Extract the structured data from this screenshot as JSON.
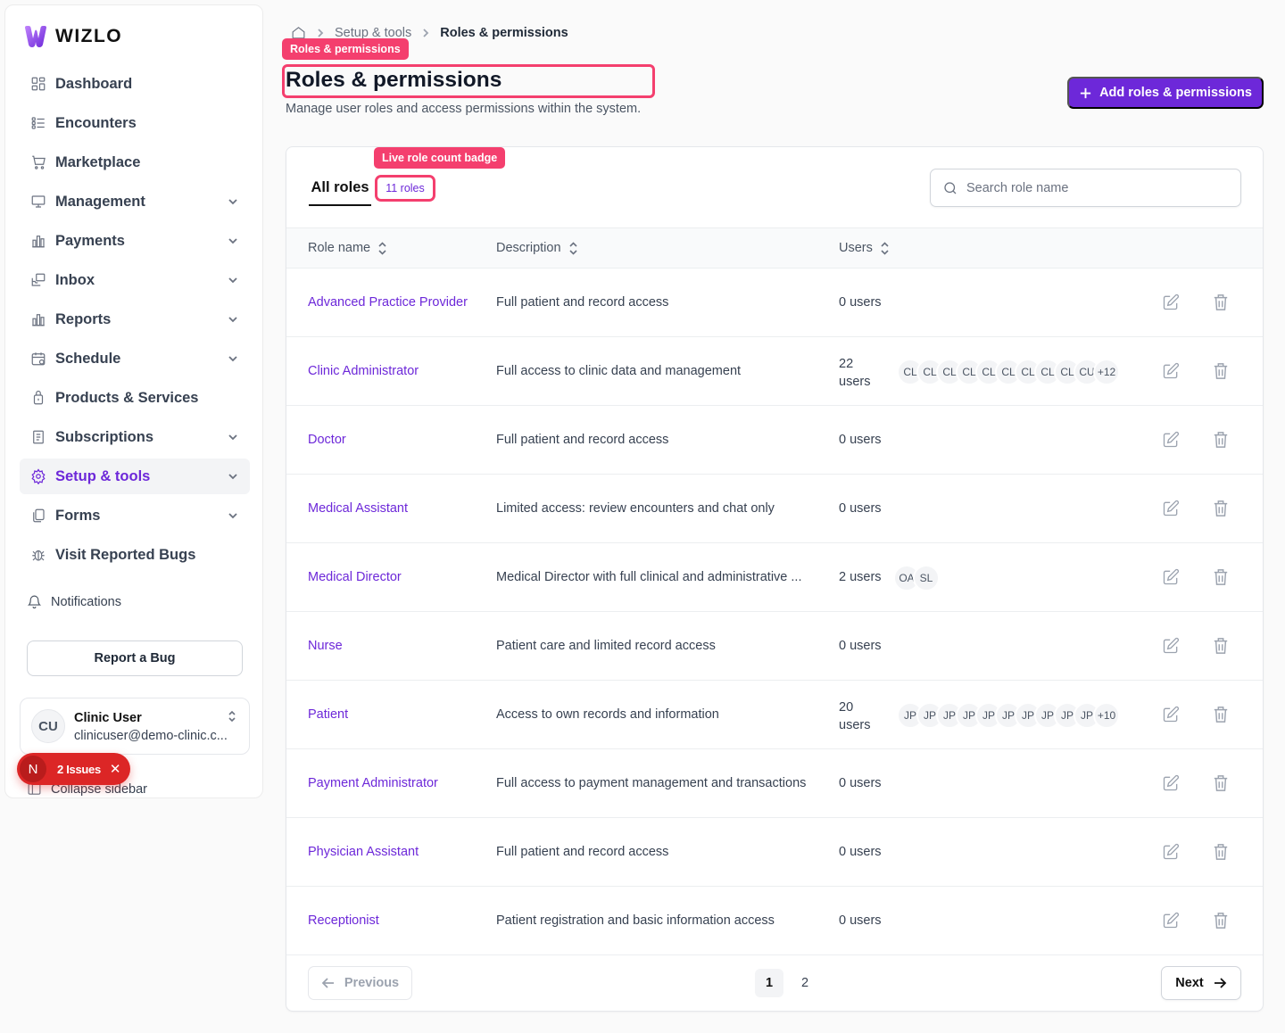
{
  "brand": {
    "name": "WIZLO"
  },
  "sidebar": {
    "items": [
      {
        "label": "Dashboard",
        "icon": "dashboard-icon",
        "chevron": false,
        "active": false
      },
      {
        "label": "Encounters",
        "icon": "list-icon",
        "chevron": false,
        "active": false
      },
      {
        "label": "Marketplace",
        "icon": "cart-icon",
        "chevron": false,
        "active": false
      },
      {
        "label": "Management",
        "icon": "monitor-icon",
        "chevron": true,
        "active": false
      },
      {
        "label": "Payments",
        "icon": "bar-chart-icon",
        "chevron": true,
        "active": false
      },
      {
        "label": "Inbox",
        "icon": "inbox-icon",
        "chevron": true,
        "active": false
      },
      {
        "label": "Reports",
        "icon": "bar-chart-icon",
        "chevron": true,
        "active": false
      },
      {
        "label": "Schedule",
        "icon": "calendar-icon",
        "chevron": true,
        "active": false
      },
      {
        "label": "Products & Services",
        "icon": "bag-icon",
        "chevron": false,
        "active": false
      },
      {
        "label": "Subscriptions",
        "icon": "document-icon",
        "chevron": true,
        "active": false
      },
      {
        "label": "Setup & tools",
        "icon": "gear-icon",
        "chevron": true,
        "active": true
      },
      {
        "label": "Forms",
        "icon": "copy-icon",
        "chevron": true,
        "active": false
      },
      {
        "label": "Visit Reported Bugs",
        "icon": "bug-icon",
        "chevron": false,
        "active": false
      }
    ],
    "notifications_label": "Notifications",
    "report_bug_label": "Report a Bug",
    "user": {
      "initials": "CU",
      "name": "Clinic User",
      "email": "clinicuser@demo-clinic.c..."
    },
    "collapse_label": "Collapse sidebar",
    "issues": {
      "letter": "N",
      "label": "2 Issues"
    }
  },
  "breadcrumb": {
    "parent": "Setup & tools",
    "current": "Roles & permissions"
  },
  "annotations": {
    "title_tag": "Roles & permissions",
    "badge_tag": "Live role count badge"
  },
  "page": {
    "title": "Roles & permissions",
    "subtitle": "Manage user roles and access permissions within the system.",
    "add_button": "Add roles & permissions"
  },
  "tabs": {
    "all_label": "All roles",
    "count_badge": "11 roles"
  },
  "search": {
    "placeholder": "Search role name",
    "value": ""
  },
  "table": {
    "headers": {
      "name": "Role name",
      "description": "Description",
      "users": "Users"
    },
    "rows": [
      {
        "name": "Advanced Practice Provider",
        "description": "Full patient and record access",
        "users": "0 users",
        "avatars": []
      },
      {
        "name": "Clinic Administrator",
        "description": "Full access to clinic data and management",
        "users": "22 users",
        "avatars": [
          "CL",
          "CL",
          "CL",
          "CL",
          "CL",
          "CL",
          "CL",
          "CL",
          "CL",
          "CU"
        ],
        "more": "+12"
      },
      {
        "name": "Doctor",
        "description": "Full patient and record access",
        "users": "0 users",
        "avatars": []
      },
      {
        "name": "Medical Assistant",
        "description": "Limited access: review encounters and chat only",
        "users": "0 users",
        "avatars": []
      },
      {
        "name": "Medical Director",
        "description": "Medical Director with full clinical and administrative ...",
        "users": "2 users",
        "avatars": [
          "OA",
          "SL"
        ]
      },
      {
        "name": "Nurse",
        "description": "Patient care and limited record access",
        "users": "0 users",
        "avatars": []
      },
      {
        "name": "Patient",
        "description": "Access to own records and information",
        "users": "20 users",
        "avatars": [
          "JP",
          "JP",
          "JP",
          "JP",
          "JP",
          "JP",
          "JP",
          "JP",
          "JP",
          "JP"
        ],
        "more": "+10"
      },
      {
        "name": "Payment Administrator",
        "description": "Full access to payment management and transactions",
        "users": "0 users",
        "avatars": []
      },
      {
        "name": "Physician Assistant",
        "description": "Full patient and record access",
        "users": "0 users",
        "avatars": []
      },
      {
        "name": "Receptionist",
        "description": "Patient registration and basic information access",
        "users": "0 users",
        "avatars": []
      }
    ]
  },
  "pagination": {
    "previous": "Previous",
    "next": "Next",
    "pages": [
      "1",
      "2"
    ],
    "current": "1"
  },
  "colors": {
    "accent": "#6d28d9",
    "annotation": "#f43f6e",
    "issues": "#dc2626"
  }
}
